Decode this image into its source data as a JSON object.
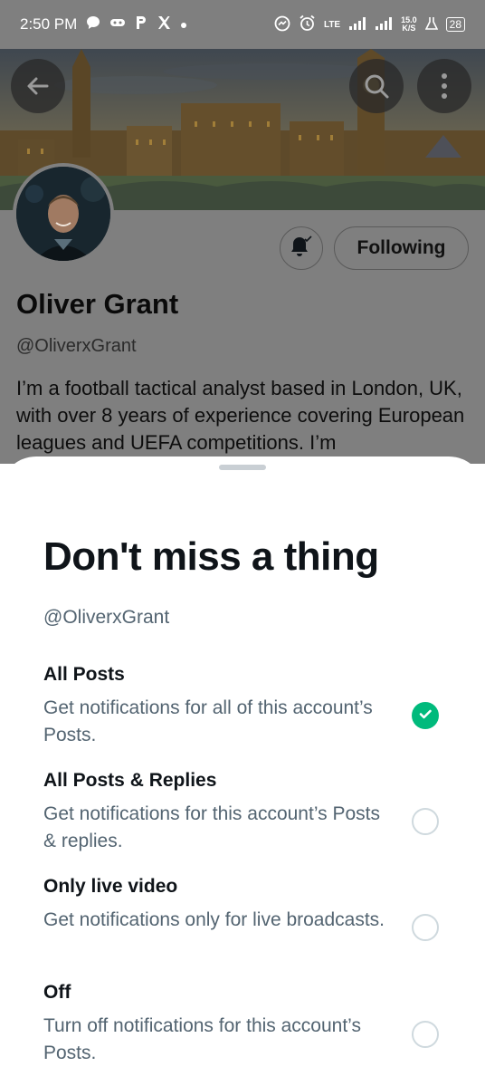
{
  "status_bar": {
    "time": "2:50 PM",
    "left_icons": [
      "chat-bubble-icon",
      "gamepad-icon",
      "p-app-icon",
      "x-app-icon",
      "dot-icon"
    ],
    "speed": "15.0",
    "speed_unit": "K/S",
    "network": "LTE",
    "battery": "28"
  },
  "profile": {
    "name": "Oliver Grant",
    "handle": "@OliverxGrant",
    "bio": "I’m a football tactical analyst based in London, UK, with over 8 years of experience covering European leagues and UEFA competitions. I’m",
    "following_label": "Following"
  },
  "sheet": {
    "title": "Don't miss a thing",
    "handle": "@OliverxGrant",
    "options": [
      {
        "title": "All Posts",
        "description": "Get notifications for all of this account’s Posts.",
        "selected": true
      },
      {
        "title": "All Posts & Replies",
        "description": "Get notifications for this account’s Posts & replies.",
        "selected": false
      },
      {
        "title": "Only live video",
        "description": "Get notifications only for live broadcasts.",
        "selected": false
      },
      {
        "title": "Off",
        "description": "Turn off notifications for this account’s Posts.",
        "selected": false
      }
    ]
  },
  "colors": {
    "accent_selected": "#00ba7c",
    "overlay": "#7f7f7f",
    "secondary_text": "#536471"
  }
}
